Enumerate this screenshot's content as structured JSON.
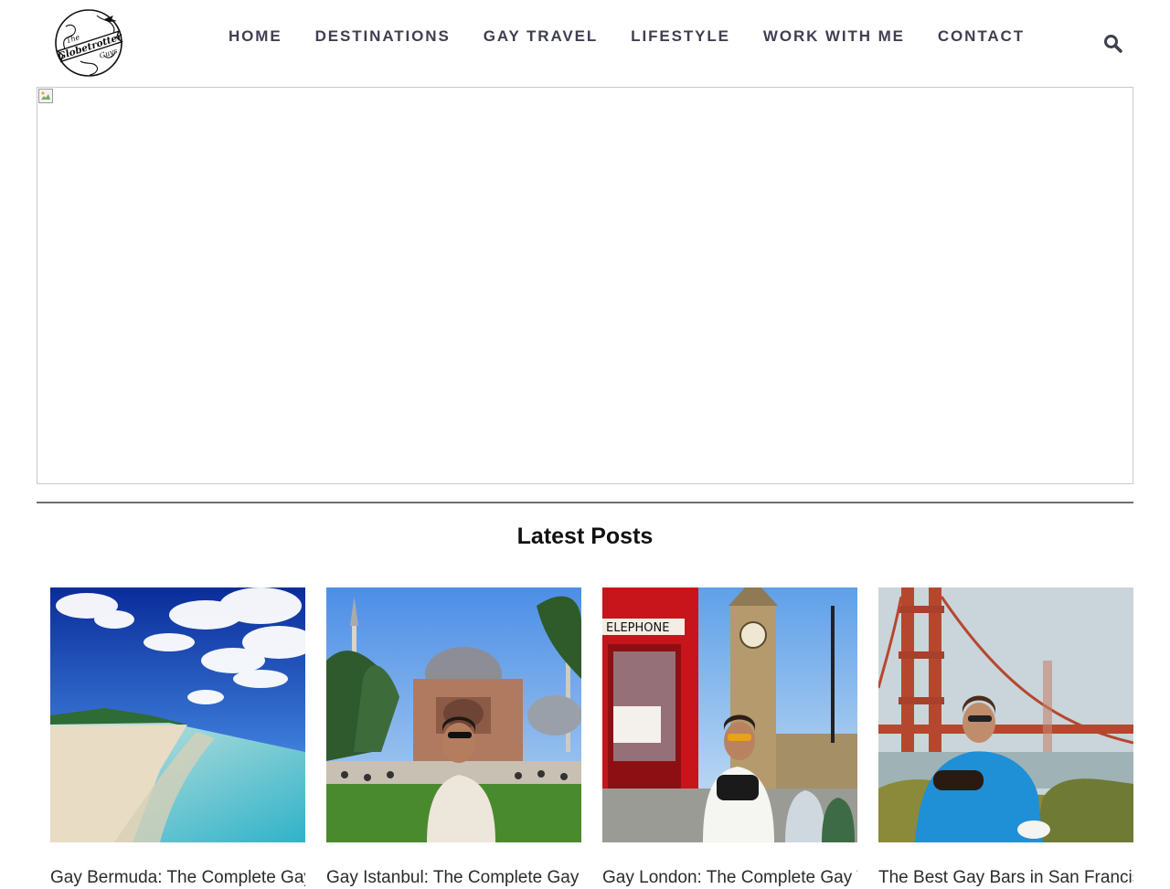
{
  "header": {
    "logo": {
      "icon": "globe-logo-icon",
      "lines": [
        "The",
        "Globetrotter",
        "Guys"
      ]
    },
    "nav": [
      {
        "label": "HOME"
      },
      {
        "label": "DESTINATIONS"
      },
      {
        "label": "GAY TRAVEL"
      },
      {
        "label": "LIFESTYLE"
      },
      {
        "label": "WORK WITH ME"
      },
      {
        "label": "CONTACT"
      }
    ],
    "search_icon": "search-icon",
    "nav_color": "#3f3f52"
  },
  "hero": {
    "image": "broken-image-icon"
  },
  "latest": {
    "title": "Latest Posts",
    "posts": [
      {
        "title": "Gay Bermuda: The Complete Gay Travel Guide",
        "image": "beach-photo"
      },
      {
        "title": "Gay Istanbul: The Complete Gay Travel Guide",
        "image": "istanbul-mosque-photo"
      },
      {
        "title": "Gay London: The Complete Gay Travel Guide",
        "image": "london-phonebox-photo"
      },
      {
        "title": "The Best Gay Bars in San Francisco",
        "image": "golden-gate-photo"
      }
    ]
  }
}
